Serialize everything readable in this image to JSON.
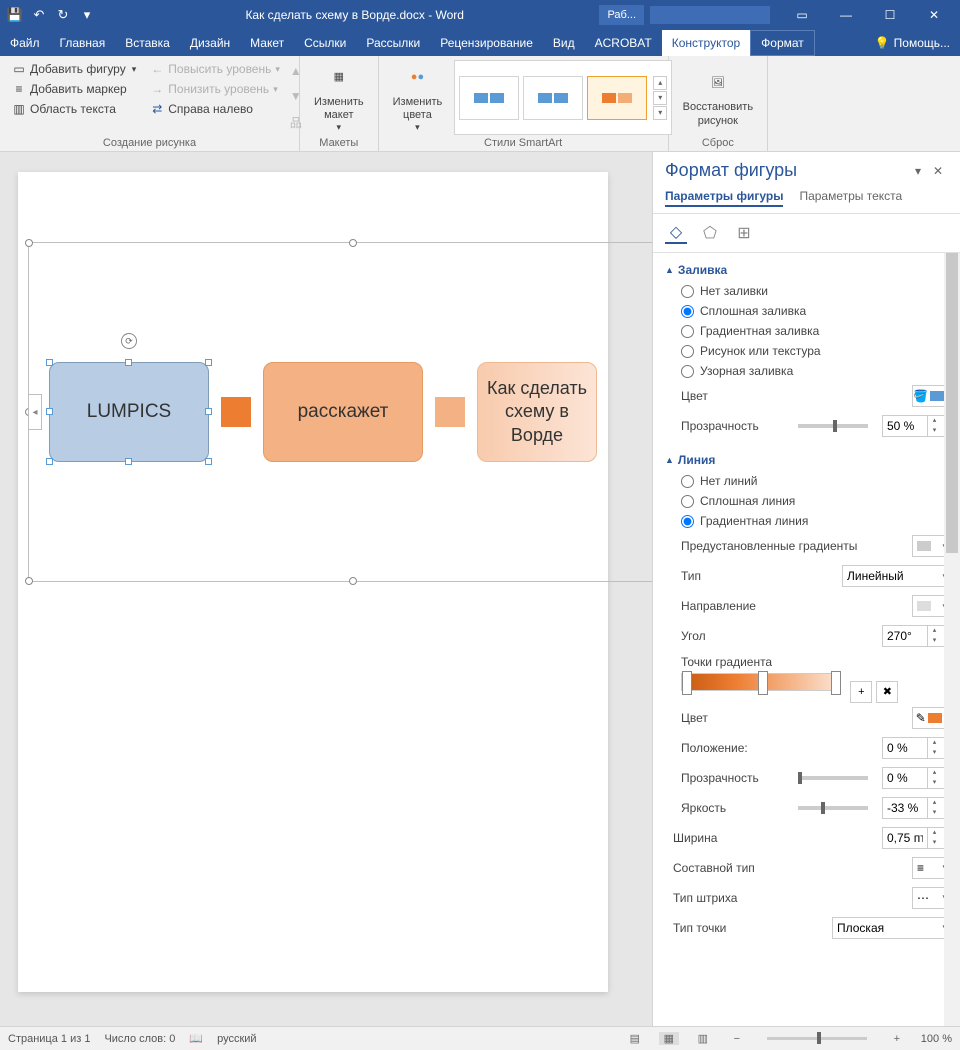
{
  "titlebar": {
    "title": "Как сделать схему в Ворде.docx - Word",
    "tool_badge": "Раб..."
  },
  "tabs": {
    "items": [
      "Файл",
      "Главная",
      "Вставка",
      "Дизайн",
      "Макет",
      "Ссылки",
      "Рассылки",
      "Рецензирование",
      "Вид",
      "ACROBAT",
      "Конструктор",
      "Формат"
    ],
    "active": "Конструктор",
    "help": "Помощь..."
  },
  "ribbon": {
    "g1": {
      "label": "Создание рисунка",
      "add_shape": "Добавить фигуру",
      "add_bullet": "Добавить маркер",
      "text_area": "Область текста",
      "promote": "Повысить уровень",
      "demote": "Понизить уровень",
      "rtl": "Справа налево"
    },
    "g2": {
      "label": "Макеты",
      "change_layout": "Изменить\nмакет"
    },
    "g3": {
      "label": "Стили SmartArt",
      "change_colors": "Изменить\nцвета"
    },
    "g4": {
      "label": "Сброс",
      "reset": "Восстановить\nрисунок"
    }
  },
  "smartart": {
    "box1": "LUMPICS",
    "box2": "расскажет",
    "box3": "Как сделать схему в Ворде"
  },
  "pane": {
    "title": "Формат фигуры",
    "tab_shape": "Параметры фигуры",
    "tab_text": "Параметры текста",
    "fill": {
      "header": "Заливка",
      "none": "Нет заливки",
      "solid": "Сплошная заливка",
      "gradient": "Градиентная заливка",
      "picture": "Рисунок или текстура",
      "pattern": "Узорная заливка",
      "color": "Цвет",
      "transparency": "Прозрачность",
      "transparency_val": "50 %"
    },
    "line": {
      "header": "Линия",
      "none": "Нет линий",
      "solid": "Сплошная линия",
      "gradient": "Градиентная линия",
      "preset": "Предустановленные градиенты",
      "type": "Тип",
      "type_val": "Линейный",
      "direction": "Направление",
      "angle": "Угол",
      "angle_val": "270°",
      "stops": "Точки градиента",
      "color": "Цвет",
      "position": "Положение:",
      "position_val": "0 %",
      "transparency": "Прозрачность",
      "transparency_val": "0 %",
      "brightness": "Яркость",
      "brightness_val": "-33 %",
      "width": "Ширина",
      "width_val": "0,75 пт",
      "compound": "Составной тип",
      "dash": "Тип штриха",
      "cap": "Тип точки",
      "cap_val": "Плоская"
    }
  },
  "statusbar": {
    "page": "Страница 1 из 1",
    "words": "Число слов: 0",
    "lang": "русский",
    "zoom": "100 %"
  }
}
